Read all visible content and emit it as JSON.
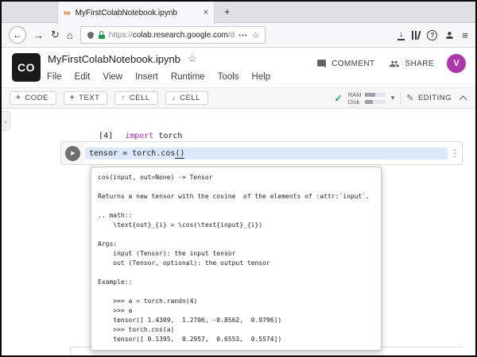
{
  "colors": {
    "highlight_blue": "#dce8fc",
    "lock_green": "#1a9b49",
    "check_green": "#0f9d58",
    "avatar_purple": "#ac38ac",
    "keyword_purple": "#a626a4",
    "favicon_orange": "#e8710a",
    "logo_black": "#1a1a1a"
  },
  "icons": {
    "favicon": "∞",
    "close_tab": "×",
    "new_tab": "+",
    "back": "←",
    "forward": "→",
    "reload": "↻",
    "home": "⌂",
    "page_actions": "•••",
    "bookmark": "☆",
    "download": "↓",
    "help": "?",
    "menu": "≡",
    "star": "☆",
    "plus": "+",
    "up": "↑",
    "down": "↓",
    "check": "✓",
    "dropdown": "▾",
    "pencil": "✎",
    "play": "▶",
    "kebab": "⋮",
    "chevron_right": "›"
  },
  "browser": {
    "tab_title": "MyFirstColabNotebook.ipynb",
    "url_scheme": "https://",
    "url_domain": "colab.research.google.com",
    "url_path": "/d"
  },
  "colab": {
    "logo_text": "CO",
    "doc_title": "MyFirstColabNotebook.ipynb",
    "comment_label": "COMMENT",
    "share_label": "SHARE",
    "avatar_initial": "V",
    "menu_items": [
      "File",
      "Edit",
      "View",
      "Insert",
      "Runtime",
      "Tools",
      "Help"
    ],
    "toolbar": {
      "code_label": "CODE",
      "text_label": "TEXT",
      "cell_up_label": "CELL",
      "cell_down_label": "CELL",
      "ram_label": "RAM",
      "disk_label": "Disk",
      "editing_label": "EDITING"
    }
  },
  "notebook": {
    "cell_import": {
      "exec_count": "[4]",
      "keyword": "import",
      "rest": " torch"
    },
    "cell_active": {
      "code_before": "tensor = torch.cos",
      "code_cursor": "()"
    },
    "tooltip": {
      "lines": [
        "cos(input, out=None) -> Tensor",
        "",
        "Returns a new tensor with the cosine  of the elements of :attr:`input`.",
        "",
        ".. math::",
        "    \\text{out}_{i} = \\cos(\\text{input}_{i})",
        "",
        "Args:",
        "    input (Tensor): the input tensor",
        "    out (Tensor, optional): the output tensor",
        "",
        "Example::",
        "",
        "    >>> a = torch.randn(4)",
        "    >>> a",
        "    tensor([ 1.4309,  1.2706, -0.8562,  0.9796])",
        "    >>> torch.cos(a)",
        "    tensor([ 0.1395,  0.2957,  0.6553,  0.5574])"
      ]
    }
  }
}
